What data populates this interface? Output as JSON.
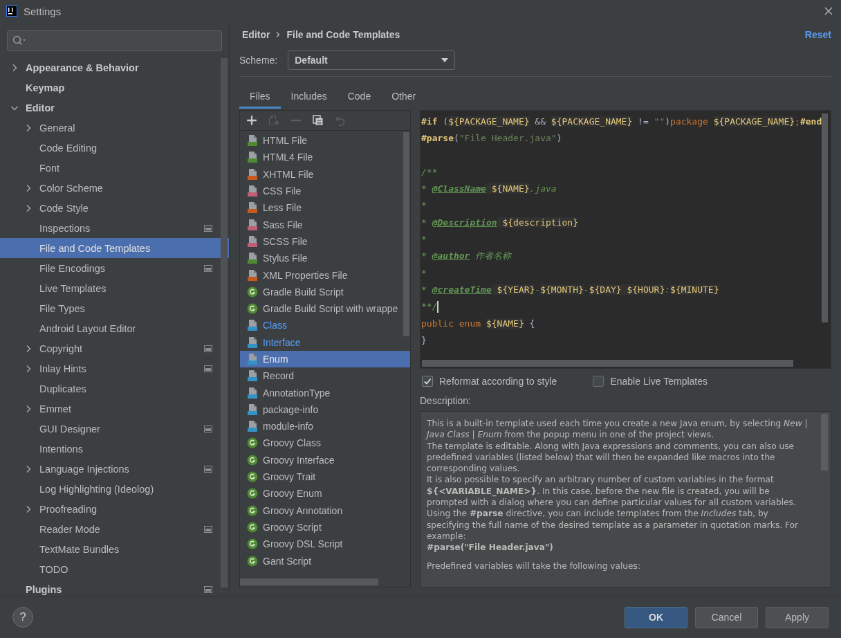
{
  "window": {
    "title": "Settings"
  },
  "sidebar": {
    "items": [
      {
        "label": "Appearance & Behavior",
        "bold": true,
        "expanded": false,
        "selected": false
      },
      {
        "label": "Keymap",
        "bold": true,
        "selected": false
      },
      {
        "label": "Editor",
        "bold": true,
        "expanded": true,
        "selected": false,
        "children": [
          {
            "label": "General",
            "expanded": false,
            "selected": false
          },
          {
            "label": "Code Editing",
            "selected": false
          },
          {
            "label": "Font",
            "selected": false
          },
          {
            "label": "Color Scheme",
            "expanded": false,
            "selected": false
          },
          {
            "label": "Code Style",
            "expanded": false,
            "selected": false
          },
          {
            "label": "Inspections",
            "project_icon": true,
            "selected": false
          },
          {
            "label": "File and Code Templates",
            "selected": true
          },
          {
            "label": "File Encodings",
            "project_icon": true,
            "selected": false
          },
          {
            "label": "Live Templates",
            "selected": false
          },
          {
            "label": "File Types",
            "selected": false
          },
          {
            "label": "Android Layout Editor",
            "selected": false
          },
          {
            "label": "Copyright",
            "expanded": false,
            "project_icon": true,
            "selected": false
          },
          {
            "label": "Inlay Hints",
            "expanded": false,
            "project_icon": true,
            "selected": false
          },
          {
            "label": "Duplicates",
            "selected": false
          },
          {
            "label": "Emmet",
            "expanded": false,
            "selected": false
          },
          {
            "label": "GUI Designer",
            "project_icon": true,
            "selected": false
          },
          {
            "label": "Intentions",
            "selected": false
          },
          {
            "label": "Language Injections",
            "expanded": false,
            "project_icon": true,
            "selected": false
          },
          {
            "label": "Log Highlighting (Ideolog)",
            "selected": false
          },
          {
            "label": "Proofreading",
            "expanded": false,
            "selected": false
          },
          {
            "label": "Reader Mode",
            "project_icon": true,
            "selected": false
          },
          {
            "label": "TextMate Bundles",
            "selected": false
          },
          {
            "label": "TODO",
            "selected": false
          }
        ]
      },
      {
        "label": "Plugins",
        "bold": true,
        "project_icon": true,
        "selected": false
      }
    ]
  },
  "breadcrumb": [
    "Editor",
    "File and Code Templates"
  ],
  "reset": "Reset",
  "scheme": {
    "label": "Scheme:",
    "value": "Default"
  },
  "tabs": [
    {
      "label": "Files",
      "selected": true
    },
    {
      "label": "Includes",
      "selected": false
    },
    {
      "label": "Code",
      "selected": false
    },
    {
      "label": "Other",
      "selected": false
    }
  ],
  "toolbar": [
    {
      "kind": "plus",
      "disabled": false
    },
    {
      "kind": "add-child",
      "disabled": true
    },
    {
      "kind": "minus",
      "disabled": true
    },
    {
      "kind": "copy",
      "disabled": false
    },
    {
      "kind": "undo",
      "disabled": true
    }
  ],
  "templates": [
    {
      "label": "HTML File",
      "kind": "file",
      "color": "#4f8a32",
      "modified": false,
      "selected": false
    },
    {
      "label": "HTML4 File",
      "kind": "file",
      "color": "#4f8a32",
      "modified": false,
      "selected": false
    },
    {
      "label": "XHTML File",
      "kind": "file",
      "color": "#c75a23",
      "modified": false,
      "selected": false
    },
    {
      "label": "CSS File",
      "kind": "file",
      "color": "#c25d78",
      "modified": false,
      "selected": false
    },
    {
      "label": "Less File",
      "kind": "file",
      "color": "#c75a23",
      "modified": false,
      "selected": false
    },
    {
      "label": "Sass File",
      "kind": "file",
      "color": "#c25d78",
      "modified": false,
      "selected": false
    },
    {
      "label": "SCSS File",
      "kind": "file",
      "color": "#c25d78",
      "modified": false,
      "selected": false
    },
    {
      "label": "Stylus File",
      "kind": "file",
      "color": "#4f8a32",
      "modified": false,
      "selected": false
    },
    {
      "label": "XML Properties File",
      "kind": "file",
      "color": "#c75a23",
      "modified": false,
      "selected": false
    },
    {
      "label": "Gradle Build Script",
      "kind": "groovy",
      "color": "#4f8a32",
      "modified": false,
      "selected": false
    },
    {
      "label": "Gradle Build Script with wrappe",
      "kind": "groovy",
      "color": "#4f8a32",
      "modified": false,
      "selected": false
    },
    {
      "label": "Class",
      "kind": "file",
      "color": "#3592c4",
      "modified": true,
      "selected": false
    },
    {
      "label": "Interface",
      "kind": "file",
      "color": "#3592c4",
      "modified": true,
      "selected": false
    },
    {
      "label": "Enum",
      "kind": "file",
      "color": "#3592c4",
      "modified": false,
      "selected": true
    },
    {
      "label": "Record",
      "kind": "file",
      "color": "#3592c4",
      "modified": false,
      "selected": false
    },
    {
      "label": "AnnotationType",
      "kind": "file",
      "color": "#3592c4",
      "modified": false,
      "selected": false
    },
    {
      "label": "package-info",
      "kind": "file",
      "color": "#3592c4",
      "modified": false,
      "selected": false
    },
    {
      "label": "module-info",
      "kind": "file",
      "color": "#3592c4",
      "modified": false,
      "selected": false
    },
    {
      "label": "Groovy Class",
      "kind": "groovy",
      "color": "#4f8a32",
      "modified": false,
      "selected": false
    },
    {
      "label": "Groovy Interface",
      "kind": "groovy",
      "color": "#4f8a32",
      "modified": false,
      "selected": false
    },
    {
      "label": "Groovy Trait",
      "kind": "groovy",
      "color": "#4f8a32",
      "modified": false,
      "selected": false
    },
    {
      "label": "Groovy Enum",
      "kind": "groovy",
      "color": "#4f8a32",
      "modified": false,
      "selected": false
    },
    {
      "label": "Groovy Annotation",
      "kind": "groovy",
      "color": "#4f8a32",
      "modified": false,
      "selected": false
    },
    {
      "label": "Groovy Script",
      "kind": "groovy",
      "color": "#4f8a32",
      "modified": false,
      "selected": false
    },
    {
      "label": "Groovy DSL Script",
      "kind": "groovy",
      "color": "#4f8a32",
      "modified": false,
      "selected": false
    },
    {
      "label": "Gant Script",
      "kind": "groovy",
      "color": "#4f8a32",
      "modified": false,
      "selected": false
    }
  ],
  "editor": {
    "lines": [
      {
        "tokens": [
          {
            "kind": "directive",
            "t": "#if"
          },
          {
            "kind": "plain",
            "t": " ("
          },
          {
            "kind": "var",
            "t": "${PACKAGE_NAME}"
          },
          {
            "kind": "plain",
            "t": " && "
          },
          {
            "kind": "var",
            "t": "${PACKAGE_NAME}"
          },
          {
            "kind": "plain",
            "t": " != "
          },
          {
            "kind": "string",
            "t": "\"\""
          },
          {
            "kind": "plain",
            "t": ")"
          },
          {
            "kind": "keyword",
            "t": "package "
          },
          {
            "kind": "var",
            "t": "${PACKAGE_NAME}"
          },
          {
            "kind": "keyword",
            "t": ";"
          },
          {
            "kind": "directive",
            "t": "#end"
          }
        ]
      },
      {
        "tokens": [
          {
            "kind": "directive",
            "t": "#parse"
          },
          {
            "kind": "plain",
            "t": "("
          },
          {
            "kind": "string",
            "t": "\"File Header.java\""
          },
          {
            "kind": "plain",
            "t": ")"
          }
        ]
      },
      {
        "tokens": [
          {
            "kind": "comment",
            "t": "/**"
          }
        ],
        "blank_before": true
      },
      {
        "tokens": [
          {
            "kind": "comment",
            "t": "* "
          },
          {
            "kind": "doctag",
            "t": "@ClassName"
          },
          {
            "kind": "var",
            "t": " ${NAME}"
          },
          {
            "kind": "comment",
            "t": ".java"
          }
        ]
      },
      {
        "tokens": [
          {
            "kind": "comment",
            "t": "*"
          }
        ]
      },
      {
        "tokens": [
          {
            "kind": "comment",
            "t": "* "
          },
          {
            "kind": "doctag",
            "t": "@Description"
          },
          {
            "kind": "var",
            "t": " ${description}"
          }
        ]
      },
      {
        "tokens": [
          {
            "kind": "comment",
            "t": "*"
          }
        ]
      },
      {
        "tokens": [
          {
            "kind": "comment",
            "t": "* "
          },
          {
            "kind": "doctag",
            "t": "@author"
          },
          {
            "kind": "comment",
            "t": " 作者名称"
          }
        ]
      },
      {
        "tokens": [
          {
            "kind": "comment",
            "t": "*"
          }
        ]
      },
      {
        "tokens": [
          {
            "kind": "comment",
            "t": "* "
          },
          {
            "kind": "doctag",
            "t": "@createTime"
          },
          {
            "kind": "var",
            "t": " ${YEAR}"
          },
          {
            "kind": "comment",
            "t": "-"
          },
          {
            "kind": "var",
            "t": "${MONTH}"
          },
          {
            "kind": "comment",
            "t": "-"
          },
          {
            "kind": "var",
            "t": "${DAY} ${HOUR}"
          },
          {
            "kind": "comment",
            "t": ":"
          },
          {
            "kind": "var",
            "t": "${MINUTE}"
          }
        ]
      },
      {
        "tokens": [
          {
            "kind": "comment",
            "t": "**/"
          }
        ],
        "caret": true
      },
      {
        "tokens": [
          {
            "kind": "keyword",
            "t": "public enum "
          },
          {
            "kind": "var",
            "t": "${NAME}"
          },
          {
            "kind": "plain",
            "t": " {"
          }
        ]
      },
      {
        "tokens": [
          {
            "kind": "plain",
            "t": "}"
          }
        ]
      }
    ]
  },
  "options": [
    {
      "label": "Reformat according to style",
      "checked": true
    },
    {
      "label": "Enable Live Templates",
      "checked": false
    }
  ],
  "description": {
    "label": "Description:",
    "paragraphs": [
      {
        "kind": "text",
        "text": "This is a built-in template used each time you create a new Java enum, by selecting *New* | *Java Class* | *Enum* from the popup menu in one of the project views."
      },
      {
        "kind": "text",
        "text": "The template is editable. Along with Java expressions and comments, you can also use predefined variables (listed below) that will then be expanded like macros into the corresponding values."
      },
      {
        "kind": "text",
        "text": "It is also possible to specify an arbitrary number of custom variables in the format **${<VARIABLE_NAME>}**. In this case, before the new file is created, you will be prompted with a dialog where you can define particular values for all custom variables."
      },
      {
        "kind": "text",
        "text": "Using the **#parse** directive, you can include templates from the *Includes* tab, by specifying the full name of the desired template as a parameter in quotation marks. For example:"
      },
      {
        "kind": "code",
        "text": "#parse(\"File Header.java\")"
      },
      {
        "kind": "note",
        "text": "Predefined variables will take the following values:"
      }
    ]
  },
  "help": "?",
  "buttons": [
    {
      "label": "OK",
      "primary": true
    },
    {
      "label": "Cancel",
      "primary": false
    },
    {
      "label": "Apply",
      "primary": false
    }
  ]
}
